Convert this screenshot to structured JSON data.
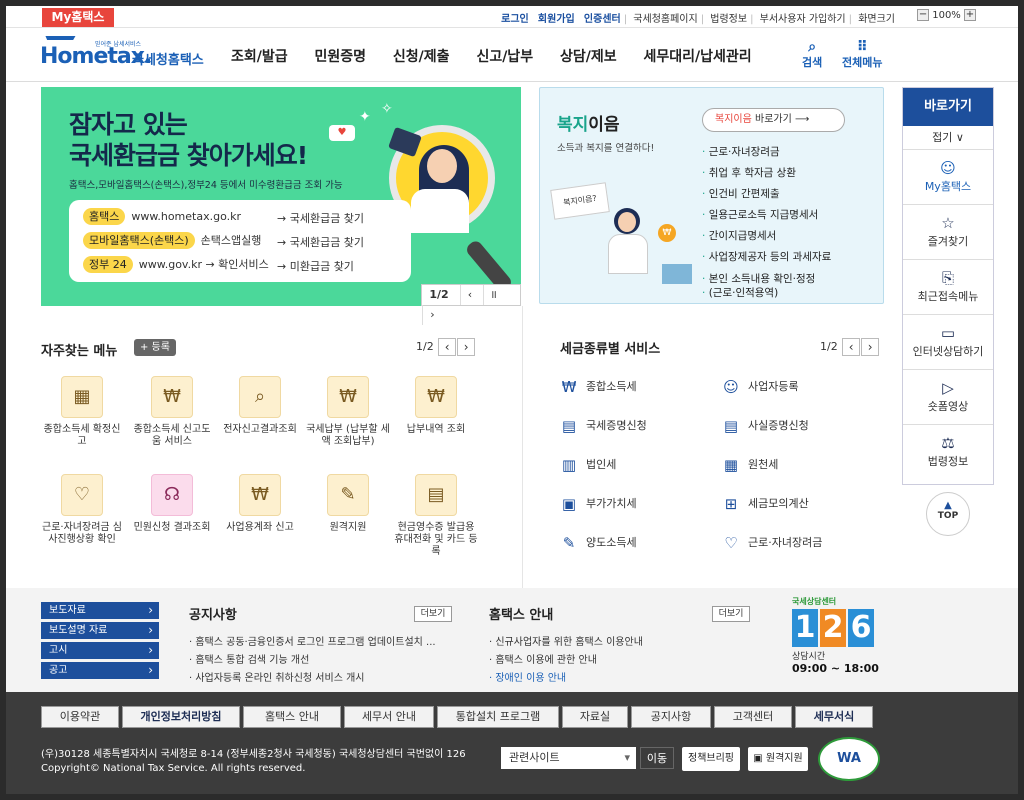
{
  "util": {
    "myhome_tab": "My홈택스",
    "links": [
      "로그인",
      "회원가입",
      "인증센터",
      "국세청홈페이지",
      "법령정보",
      "부서사용자 가입하기",
      "화면크기"
    ],
    "zoom_minus": "−",
    "zoom_value": "100%",
    "zoom_plus": "+"
  },
  "header": {
    "logo_text": "Hometax.",
    "logo_sub": "믿어준 납세서비스",
    "logo_kor": "국세청홈택스",
    "nav": [
      "조회/발급",
      "민원증명",
      "신청/제출",
      "신고/납부",
      "상담/제보",
      "세무대리/납세관리"
    ],
    "search_label": "검색",
    "all_menu_label": "전체메뉴"
  },
  "banner1": {
    "title_line1": "잠자고 있는",
    "title_line2": "국세환급금 찾아가세요!",
    "desc": "홈택스,모바일홈택스(손택스),정부24 등에서 미수령환급금 조회 가능",
    "rows": [
      {
        "tag": "홈택스",
        "text": "www.hometax.go.kr",
        "arrow": "→ 국세환급금 찾기"
      },
      {
        "tag": "모바일홈택스(손택스)",
        "text": "손택스앱실행",
        "arrow": "→ 국세환급금 찾기"
      },
      {
        "tag": "정부 24",
        "text": "www.gov.kr → 확인서비스",
        "arrow": "→ 미환급금 찾기"
      }
    ],
    "pager": "1/2"
  },
  "banner2": {
    "title_a": "복지",
    "title_b": "이음",
    "desc": "소득과 복지를 연결하다!",
    "btn_hl": "복지이음",
    "btn_text": " 바로가기",
    "illus_note": "복지이음?",
    "items": [
      "근로·자녀장려금",
      "취업 후 학자금 상환",
      "인건비 간편제출",
      "일용근로소득 지급명세서",
      "간이지급명세서",
      "사업장제공자 등의 과세자료",
      "본인 소득내용 확인·정정",
      "(근로·인적용역)"
    ]
  },
  "quick": {
    "head": "바로가기",
    "fold": "접기 ∨",
    "items": [
      {
        "label": "My홈택스",
        "icon": "user-icon"
      },
      {
        "label": "즐겨찾기",
        "icon": "star-icon"
      },
      {
        "label": "최근접속메뉴",
        "icon": "recent-icon"
      },
      {
        "label": "인터넷상담하기",
        "icon": "monitor-icon"
      },
      {
        "label": "숏폼영상",
        "icon": "play-icon"
      },
      {
        "label": "법령정보",
        "icon": "gavel-icon"
      }
    ],
    "top": "TOP"
  },
  "fav": {
    "title": "자주찾는 메뉴",
    "register": "+ 등록",
    "pager": "1/2",
    "items": [
      "종합소득세 확정신고",
      "종합소득세 신고도움 서비스",
      "전자신고결과조회",
      "국세납부 (납부할 세액 조회납부)",
      "납부내역 조회",
      "근로·자녀장려금 심사진행상황 확인",
      "민원신청 결과조회",
      "사업용계좌 신고",
      "원격지원",
      "현금영수증 발급용 휴대전화 및 카드 등록"
    ]
  },
  "taxsvc": {
    "title": "세금종류별 서비스",
    "pager": "1/2",
    "items": [
      "종합소득세",
      "사업자등록",
      "국세증명신청",
      "사실증명신청",
      "법인세",
      "원천세",
      "부가가치세",
      "세금모의계산",
      "양도소득세",
      "근로·자녀장려금"
    ]
  },
  "band": {
    "side": [
      "보도자료",
      "보도설명 자료",
      "고시",
      "공고"
    ],
    "notice_title": "공지사항",
    "notice_more": "더보기",
    "notices": [
      "홈택스 공동·금융인증서 로그인 프로그램 업데이트설치 ...",
      "홈택스 통합 검색 기능 개선",
      "사업자등록 온라인 취하신청 서비스 개시"
    ],
    "guide_title": "홈택스 안내",
    "guide_more": "더보기",
    "guides": [
      "신규사업자를 위한 홈택스 이용안내",
      "홈택스 이용에 관한 안내",
      "장애인 이용 안내"
    ],
    "center_label": "국세상담센터",
    "center_digits": [
      "1",
      "2",
      "6"
    ],
    "center_hours_label": "상담시간",
    "center_hours": "09:00 ~ 18:00"
  },
  "footer": {
    "nav": [
      "이용약관",
      "개인정보처리방침",
      "홈택스 안내",
      "세무서 안내",
      "통합설치 프로그램",
      "자료실",
      "공지사항",
      "고객센터",
      "세무서식"
    ],
    "address": "(우)30128 세종특별자치시 국세청로 8-14 (정부세종2청사 국세청동) 국세청상담센터 국번없이 126",
    "copyright": "Copyright© National Tax Service. All rights reserved.",
    "related_select": "관련사이트",
    "go": "이동",
    "badge1": "정책브리핑",
    "badge2": "원격지원",
    "wa": "WA"
  },
  "colors": {
    "accent": "#1d4f9c",
    "brand": "#1b60b6",
    "banner_green": "#4bd89a",
    "red_tab": "#e8453c"
  }
}
